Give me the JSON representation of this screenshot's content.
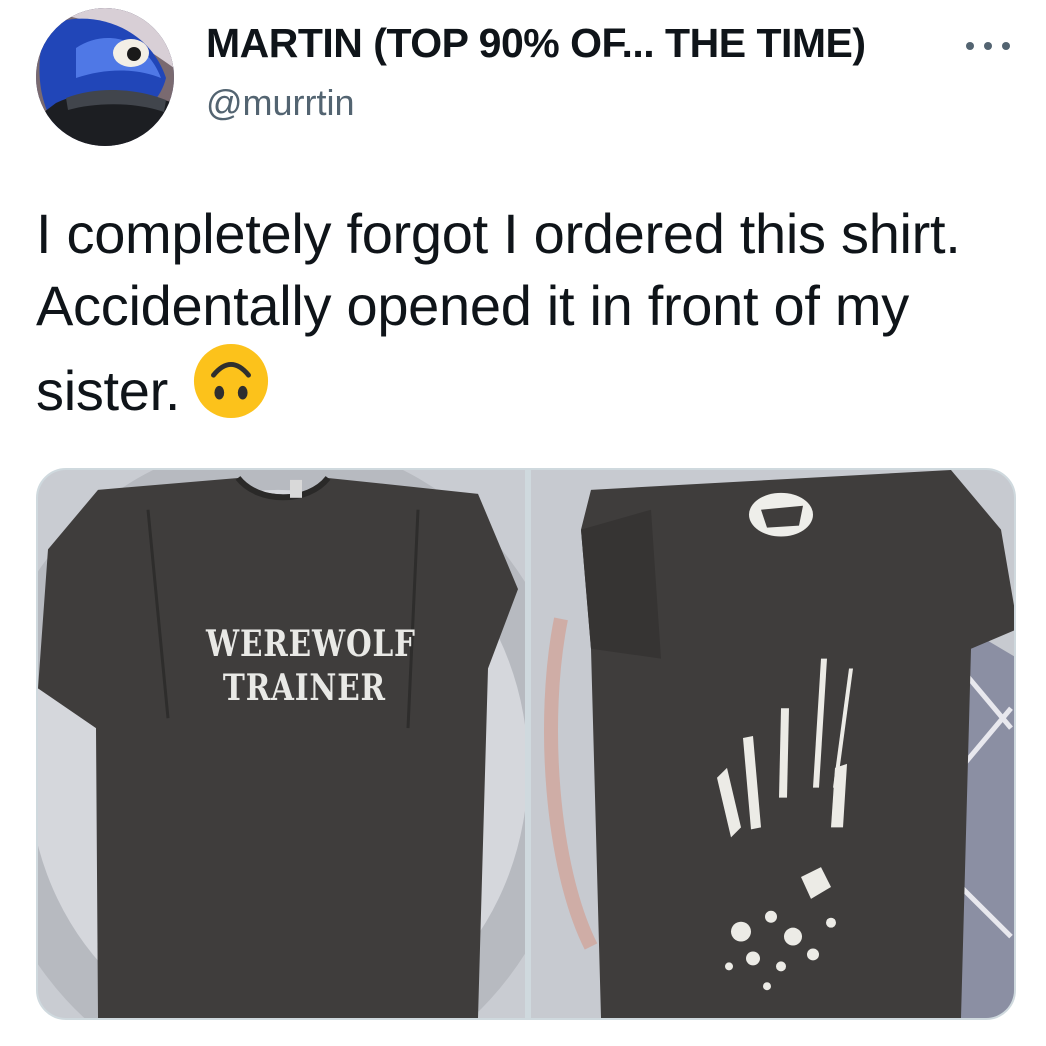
{
  "user": {
    "display_name": "MARTIN (TOP 90% OF... THE TIME)",
    "handle": "@murrtin",
    "avatar_icon": "blue-bird-avatar-icon"
  },
  "menu": {
    "icon": "more-horizontal-icon"
  },
  "tweet": {
    "text": "I completely forgot I ordered this shirt. Accidentally opened it in front of my sister.",
    "emoji": "upside-down-face-emoji"
  },
  "media": {
    "photos": [
      {
        "shirt_print_line1": "WEREWOLF",
        "shirt_print_line2": "TRAINER"
      },
      {
        "print_icon": "handprint-splatter-icon",
        "collar_logo_icon": "logo-icon"
      }
    ]
  },
  "colors": {
    "text_primary": "#0f1419",
    "text_secondary": "#536471",
    "border": "#cfd9de",
    "shirt": "#3f3d3c"
  }
}
